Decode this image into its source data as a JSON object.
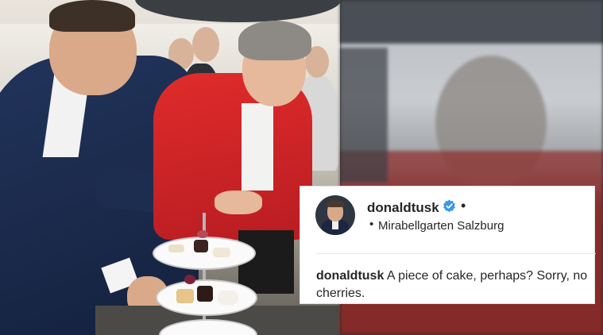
{
  "post": {
    "username": "donaldtusk",
    "header_dot": "•",
    "location_bullet": "•",
    "location": "Mirabellgarten Salzburg",
    "caption_username": "donaldtusk",
    "caption_text": "A piece of cake, perhaps? Sorry, no cherries."
  },
  "icons": {
    "verified": "verified-badge-icon"
  },
  "colors": {
    "verified_blue": "#3897f0",
    "text": "#262626",
    "jacket_red": "#d42a2a"
  }
}
